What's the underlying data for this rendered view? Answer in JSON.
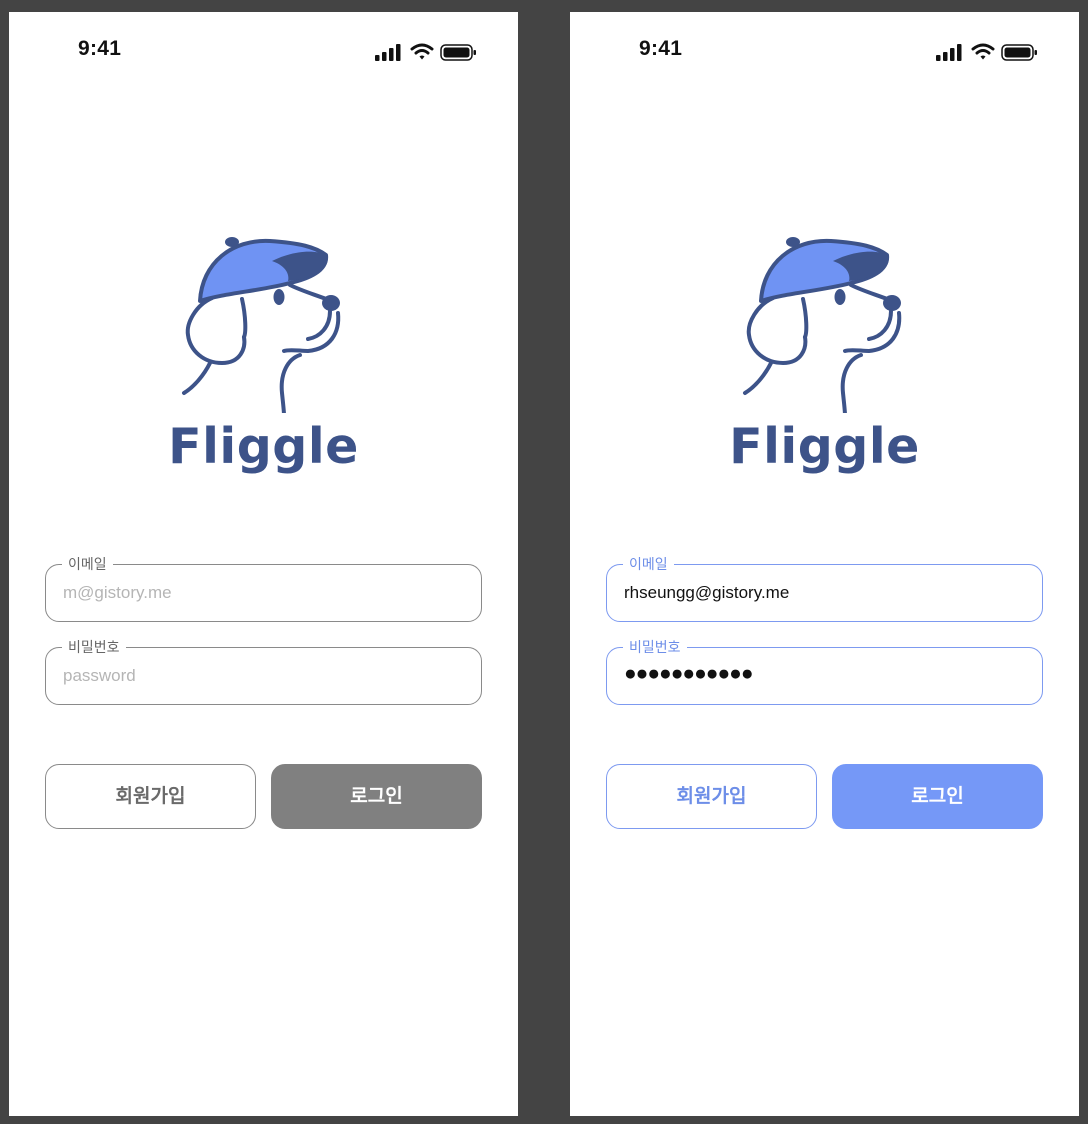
{
  "status_bar": {
    "time": "9:41"
  },
  "app": {
    "name": "Fliggle"
  },
  "screens": {
    "empty": {
      "email_label": "이메일",
      "email_placeholder": "m@gistory.me",
      "password_label": "비밀번호",
      "password_placeholder": "password",
      "signup_label": "회원가입",
      "login_label": "로그인"
    },
    "filled": {
      "email_label": "이메일",
      "email_value": "rhseungg@gistory.me",
      "password_label": "비밀번호",
      "password_value": "●●●●●●●●●●●",
      "signup_label": "회원가입",
      "login_label": "로그인"
    }
  },
  "colors": {
    "background": "#444444",
    "brand_navy": "#3d5389",
    "cap_blue": "#6f93f3",
    "accent_blue": "#7598f7",
    "disabled_gray": "#808080"
  },
  "icons": [
    "signal-icon",
    "wifi-icon",
    "battery-icon",
    "fliggle-dog-logo"
  ]
}
